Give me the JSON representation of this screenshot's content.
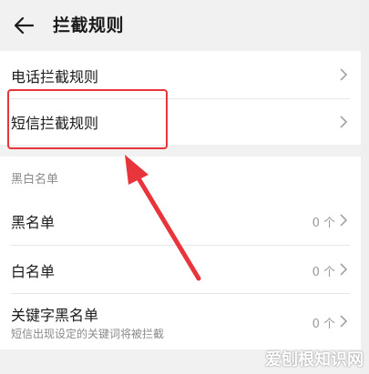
{
  "header": {
    "title": "拦截规则",
    "back_icon": "arrow-left-icon"
  },
  "card1": {
    "items": [
      {
        "label": "电话拦截规则"
      },
      {
        "label": "短信拦截规则"
      }
    ]
  },
  "lists": {
    "section_title": "黑白名单",
    "items": [
      {
        "label": "黑名单",
        "count": "0 个"
      },
      {
        "label": "白名单",
        "count": "0 个"
      },
      {
        "label": "关键字黑名单",
        "sub": "短信出现设定的关键词将被拦截",
        "count": "0 个"
      }
    ]
  },
  "annotation": {
    "highlight_color": "#e8343b"
  },
  "watermark": {
    "text": "爱刨根知识网"
  }
}
